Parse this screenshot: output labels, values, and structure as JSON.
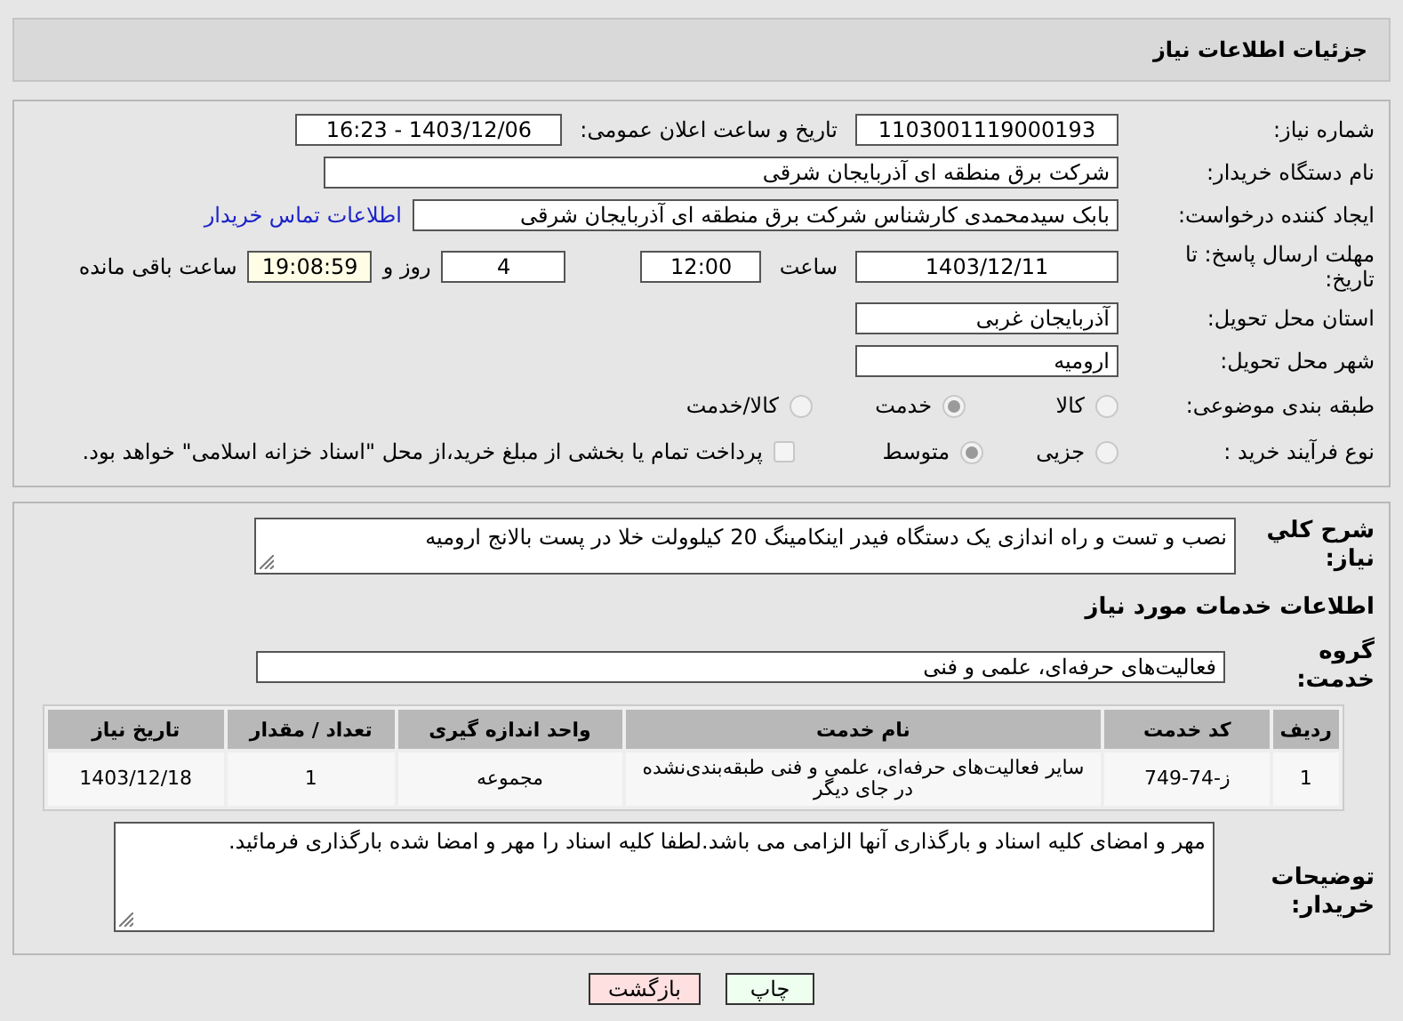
{
  "header": {
    "title": "جزئیات اطلاعات نیاز"
  },
  "details": {
    "need_number": {
      "label": "شماره نیاز:",
      "value": "1103001119000193"
    },
    "announce": {
      "label": "تاریخ و ساعت اعلان عمومی:",
      "value": "1403/12/06 - 16:23"
    },
    "buyer": {
      "label": "نام دستگاه خریدار:",
      "value": "شرکت برق منطقه ای آذربایجان شرقی"
    },
    "requester": {
      "label": "ایجاد کننده درخواست:",
      "value": "بابک سیدمحمدی کارشناس شرکت برق منطقه ای آذربایجان شرقی",
      "link": "اطلاعات تماس خریدار"
    },
    "deadline": {
      "label": "مهلت ارسال پاسخ: تا تاریخ:",
      "date": "1403/12/11",
      "time_label": "ساعت",
      "time": "12:00",
      "days": "4",
      "days_label": "روز و",
      "remaining": "19:08:59",
      "remaining_label": "ساعت باقی مانده"
    },
    "province": {
      "label": "استان محل تحویل:",
      "value": "آذربایجان غربی"
    },
    "city": {
      "label": "شهر محل تحویل:",
      "value": "ارومیه"
    },
    "category": {
      "label": "طبقه بندی موضوعی:",
      "options": [
        {
          "label": "کالا",
          "selected": false
        },
        {
          "label": "خدمت",
          "selected": true
        },
        {
          "label": "کالا/خدمت",
          "selected": false
        }
      ]
    },
    "process": {
      "label": "نوع فرآیند خرید :",
      "options": [
        {
          "label": "جزیی",
          "selected": false
        },
        {
          "label": "متوسط",
          "selected": true
        }
      ],
      "payment": {
        "checked": false,
        "text": "پرداخت تمام یا بخشی از مبلغ خرید،از محل \"اسناد خزانه اسلامی\" خواهد بود."
      }
    }
  },
  "services": {
    "summary": {
      "label": "شرح کلي نياز:",
      "value": "نصب و تست و راه اندازی یک دستگاه فیدر اینکامینگ 20 کیلوولت خلا در پست بالانج ارومیه"
    },
    "heading": "اطلاعات خدمات مورد نیاز",
    "group": {
      "label": "گروه خدمت:",
      "value": "فعالیت‌های حرفه‌ای، علمی و فنی"
    },
    "table": {
      "columns": [
        "ردیف",
        "کد خدمت",
        "نام خدمت",
        "واحد اندازه گیری",
        "تعداد / مقدار",
        "تاریخ نیاز"
      ],
      "rows": [
        [
          "1",
          "ز-74-749",
          "سایر فعالیت‌های حرفه‌ای، علمی و فنی طبقه‌بندی‌نشده در جای دیگر",
          "مجموعه",
          "1",
          "1403/12/18"
        ]
      ]
    },
    "notes": {
      "label": "توضیحات خریدار:",
      "value": "مهر و امضای کلیه اسناد و بارگذاری آنها الزامی می باشد.لطفا کلیه اسناد را مهر و امضا شده بارگذاری فرمائید."
    }
  },
  "buttons": [
    {
      "label": "چاپ",
      "kind": "print"
    },
    {
      "label": "بازگشت",
      "kind": "back"
    }
  ]
}
